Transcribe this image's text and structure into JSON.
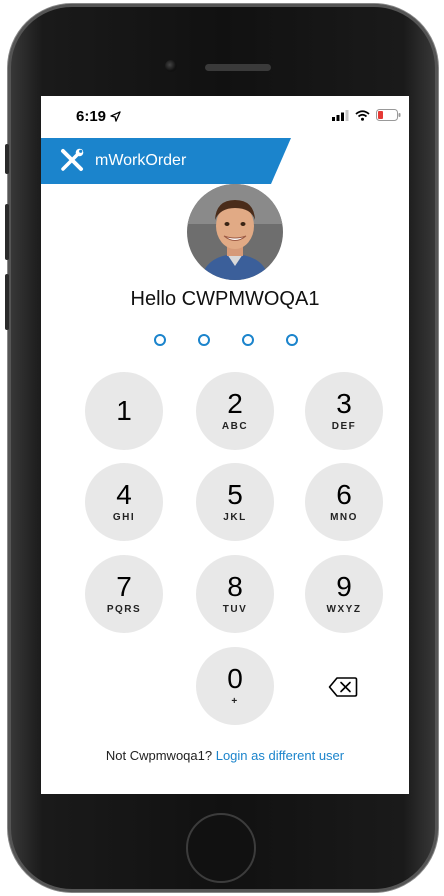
{
  "status_bar": {
    "time": "6:19",
    "location_icon": "location-arrow-icon",
    "signal_icon": "signal-icon",
    "wifi_icon": "wifi-icon",
    "battery_icon": "battery-icon"
  },
  "brand": {
    "name": "mWorkOrder",
    "icon": "tools-icon",
    "color": "#1b84cc"
  },
  "user": {
    "greeting": "Hello CWPMWOQA1"
  },
  "pin": {
    "length": 4,
    "filled": 0
  },
  "keypad": {
    "keys": [
      {
        "digit": "1",
        "letters": ""
      },
      {
        "digit": "2",
        "letters": "ABC"
      },
      {
        "digit": "3",
        "letters": "DEF"
      },
      {
        "digit": "4",
        "letters": "GHI"
      },
      {
        "digit": "5",
        "letters": "JKL"
      },
      {
        "digit": "6",
        "letters": "MNO"
      },
      {
        "digit": "7",
        "letters": "PQRS"
      },
      {
        "digit": "8",
        "letters": "TUV"
      },
      {
        "digit": "9",
        "letters": "WXYZ"
      },
      {
        "digit": "0",
        "letters": "+"
      }
    ],
    "backspace_icon": "backspace-icon"
  },
  "footer": {
    "prompt": "Not Cwpmwoqa1?",
    "link": "Login as different user"
  }
}
